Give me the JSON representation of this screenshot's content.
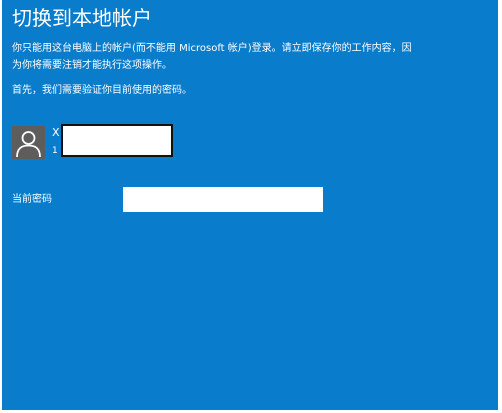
{
  "page": {
    "title": "切换到本地帐户",
    "description_line1": "你只能用这台电脑上的帐户(而不能用 Microsoft 帐户)登录。请立即保存你的工作内容，因",
    "description_line2": "为你将需要注销才能执行这项操作。",
    "verify_prompt": "首先，我们需要验证你目前使用的密码。"
  },
  "account": {
    "avatar_icon": "user-avatar-icon",
    "name_visible": "X",
    "subtext_visible": "1",
    "redacted": true
  },
  "password": {
    "label": "当前密码",
    "value": ""
  },
  "colors": {
    "background": "#0a7ccc",
    "text": "#ffffff",
    "avatar_bg": "#5d5d5d",
    "input_bg": "#ffffff"
  }
}
